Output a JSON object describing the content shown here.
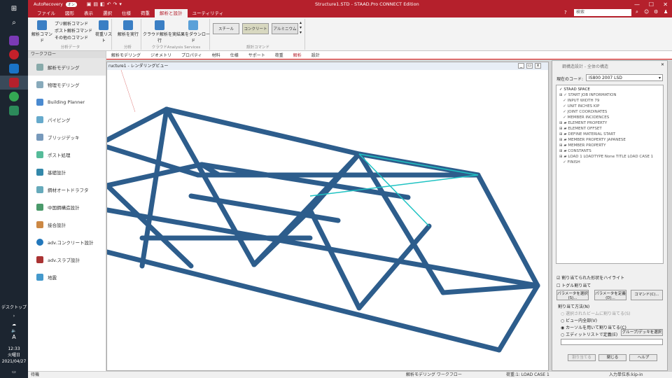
{
  "taskbar": {
    "clock_time": "12:33",
    "clock_day": "火曜日",
    "clock_date": "2021/04/27",
    "desktop_label": "デスクトップ",
    "ime_label": "A"
  },
  "titlebar": {
    "autorecovery": "AutoRecovery",
    "toggle": "オン",
    "title": "Structure1.STD - STAAD.Pro CONNECT Edition",
    "search_placeholder": "検索"
  },
  "ribbon_tabs": [
    "ファイル",
    "図形",
    "表示",
    "選択",
    "仕様",
    "荷重",
    "解析と設計",
    "ユーティリティ"
  ],
  "ribbon": {
    "btn_analysis_cmd": "解析コマンド",
    "btn_print_cmd": "プリ解析コマンド",
    "btn_post_cmd": "ポスト解析コマンド",
    "btn_other_cmd": "その他のコマンド",
    "btn_load_list": "荷重リスト",
    "group_analysis_data": "分析データ",
    "btn_run": "解析を実行",
    "group_analysis": "分析",
    "btn_cloud_run": "クラウド解析を実行",
    "btn_download": "結果をダウンロード",
    "group_cloud": "クラウドAnalysis Services",
    "mat_steel": "スチール",
    "mat_concrete": "コンクリート",
    "mat_aluminum": "アルミニウム",
    "group_design": "設計コマンド"
  },
  "workflow": {
    "header": "ワークフロー",
    "items": [
      "解析モデリング",
      "物理モデリング",
      "Building Planner",
      "パイピング",
      "ブリッジデッキ",
      "ポスト処理",
      "基礎設計",
      "鋼材オートドラフタ",
      "中国鋼構造設計",
      "接合設計",
      "adv.コンクリート設計",
      "adv.スラブ設計",
      "地震"
    ]
  },
  "page_tabs": {
    "active": "解析モデリング",
    "items": [
      "ジオメトリ",
      "プロパティ",
      "材料",
      "仕様",
      "サポート",
      "荷重",
      "解析",
      "設計"
    ]
  },
  "viewport": {
    "title": "ructure1 - レンダリングビュー"
  },
  "panel": {
    "title": "鋼構造設計 - 全体の構造",
    "code_label": "現在のコード:",
    "code_value": "IS800 2007 LSD",
    "tree": [
      "STAAD SPACE",
      "START JOB INFORMATION",
      "INPUT WIDTH 79",
      "UNIT INCHES KIP",
      "JOINT COORDINATES",
      "MEMBER INCIDENCES",
      "ELEMENT PROPERTY",
      "ELEMENT OFFSET",
      "DEFINE MATERIAL START",
      "MEMBER PROPERTY JAPANESE",
      "MEMBER PROPERTY",
      "CONSTANTS",
      "LOAD 1 LOADTYPE None  TITLE LOAD CASE 1",
      "FINISH"
    ],
    "chk_highlight": "割り当てられた形状をハイライト",
    "chk_toggle": "トグル割り当て",
    "btn_select_params": "パラメータを選択(S)...",
    "btn_define_params": "パラメータを定義(D)...",
    "btn_command": "コマンド(C)...",
    "assign_method": "割り当て方法(N)",
    "radio_selected": "選択されたビームに割り当てる(S)",
    "radio_view": "ビュー内全部(V)",
    "radio_cursor": "カーソルを用いて割り当てる(C)",
    "radio_editlist": "エディットリストで定義(E)",
    "btn_group": "グループ/デッキを選択",
    "btn_assign": "割り当てる",
    "btn_close": "閉じる",
    "btn_help": "ヘルプ"
  },
  "status": {
    "left": "待機",
    "mid": "解析モデリング ワークフロー",
    "load": "荷重:1: LOAD CASE 1",
    "unit": "入力単位系:kip-in"
  }
}
